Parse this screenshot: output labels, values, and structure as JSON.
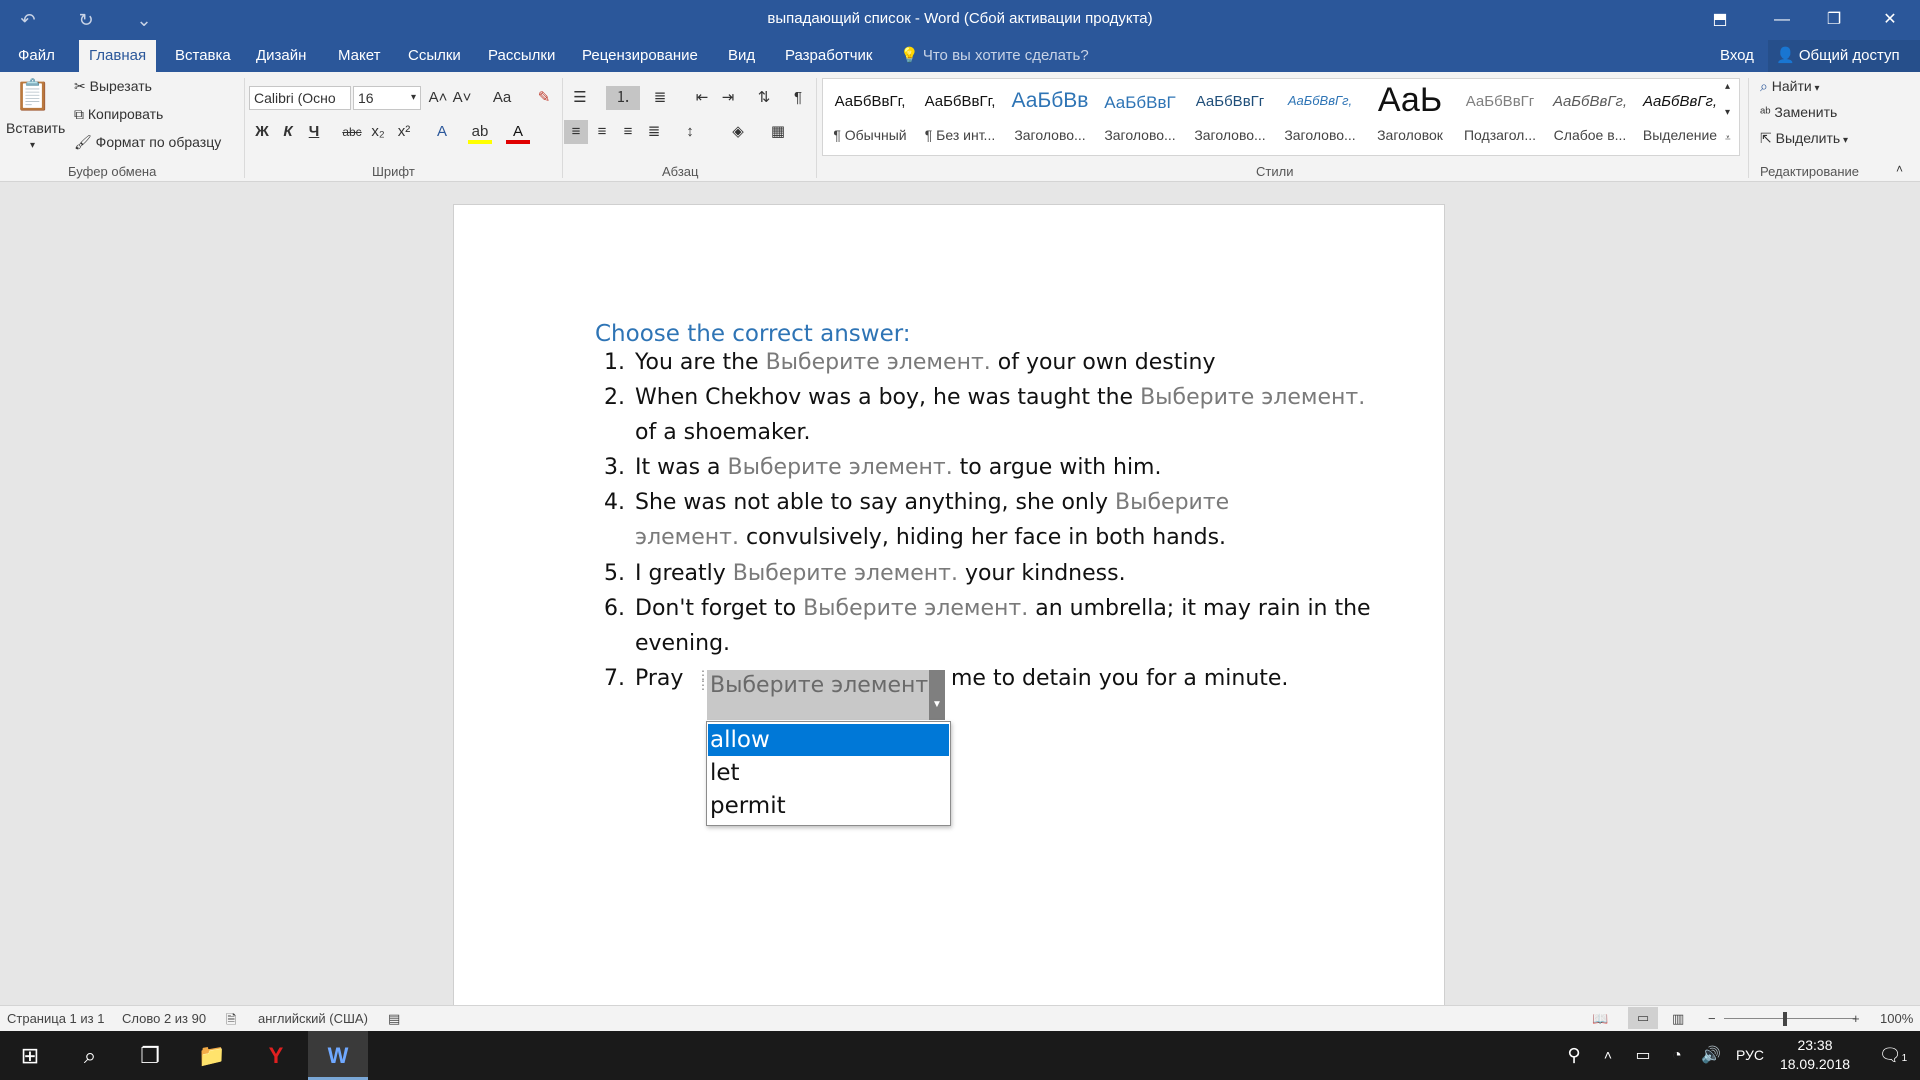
{
  "window": {
    "title": "выпадающий список - Word (Сбой активации продукта)",
    "controls": {
      "restore_icon": "restore-ribbon-icon",
      "minimize": "—",
      "maximize": "❐",
      "close": "✕"
    }
  },
  "quick_access": {
    "undo": "↶",
    "redo": "↻",
    "customize": "⌄"
  },
  "tabs": [
    "Файл",
    "Главная",
    "Вставка",
    "Дизайн",
    "Макет",
    "Ссылки",
    "Рассылки",
    "Рецензирование",
    "Вид",
    "Разработчик"
  ],
  "active_tab": "Главная",
  "tell_me": "Что вы хотите сделать?",
  "login": "Вход",
  "share": "Общий доступ",
  "ribbon": {
    "clipboard": {
      "paste": "Вставить",
      "cut": "Вырезать",
      "copy": "Копировать",
      "format_painter": "Формат по образцу",
      "label": "Буфер обмена"
    },
    "font": {
      "family": "Calibri (Осно",
      "size": "16",
      "bold": "Ж",
      "italic": "К",
      "underline": "Ч",
      "strike": "abc",
      "subscript": "x₂",
      "superscript": "x²",
      "grow": "A˄",
      "shrink": "A˅",
      "case": "Aa",
      "label": "Шрифт"
    },
    "paragraph": {
      "label": "Абзац"
    },
    "styles": {
      "label": "Стили",
      "items": [
        {
          "preview": "АаБбВвГг,",
          "name": "¶ Обычный"
        },
        {
          "preview": "АаБбВвГг,",
          "name": "¶ Без инт..."
        },
        {
          "preview": "АаБбВв",
          "name": "Заголово..."
        },
        {
          "preview": "АаБбВвГ",
          "name": "Заголово..."
        },
        {
          "preview": "АаБбВвГг",
          "name": "Заголово..."
        },
        {
          "preview": "АаБбВвГг,",
          "name": "Заголово..."
        },
        {
          "preview": "АаЬ",
          "name": "Заголовок"
        },
        {
          "preview": "АаБбВвГг",
          "name": "Подзагол..."
        },
        {
          "preview": "АаБбВвГг,",
          "name": "Слабое в..."
        },
        {
          "preview": "АаБбВвГг,",
          "name": "Выделение"
        }
      ]
    },
    "editing": {
      "find": "Найти",
      "replace": "Заменить",
      "select": "Выделить",
      "label": "Редактирование"
    }
  },
  "document": {
    "heading": "Choose the correct answer:",
    "placeholder": "Выберите элемент.",
    "items": [
      {
        "num": "1.",
        "before": "You are the ",
        "after": " of your own destiny"
      },
      {
        "num": "2.",
        "before": "When Chekhov was a boy, he was taught the ",
        "after": "",
        "line2": "of a shoemaker."
      },
      {
        "num": "3.",
        "before": "It was a ",
        "after": " to argue with him."
      },
      {
        "num": "4.",
        "before": "She was not able to say anything, she only ",
        "ph_part1": "Выберите",
        "line2_ph": "элемент.",
        "line2": " convulsively, hiding her face in both hands."
      },
      {
        "num": "5.",
        "before": "I greatly ",
        "after": " your kindness."
      },
      {
        "num": "6.",
        "before": "Don't forget to ",
        "after": " an umbrella; it may rain in the",
        "line2": "evening."
      },
      {
        "num": "7.",
        "before": "Pray ",
        "after": "me to detain you for a minute."
      }
    ],
    "dropdown": {
      "options": [
        "allow",
        "let",
        "permit"
      ],
      "selected": "allow"
    }
  },
  "status": {
    "page": "Страница 1 из 1",
    "words": "Слово 2 из 90",
    "language": "английский (США)",
    "zoom": "100%",
    "zoom_level": 100
  },
  "taskbar": {
    "lang": "РУС",
    "time": "23:38",
    "date": "18.09.2018",
    "notifications": "1"
  }
}
